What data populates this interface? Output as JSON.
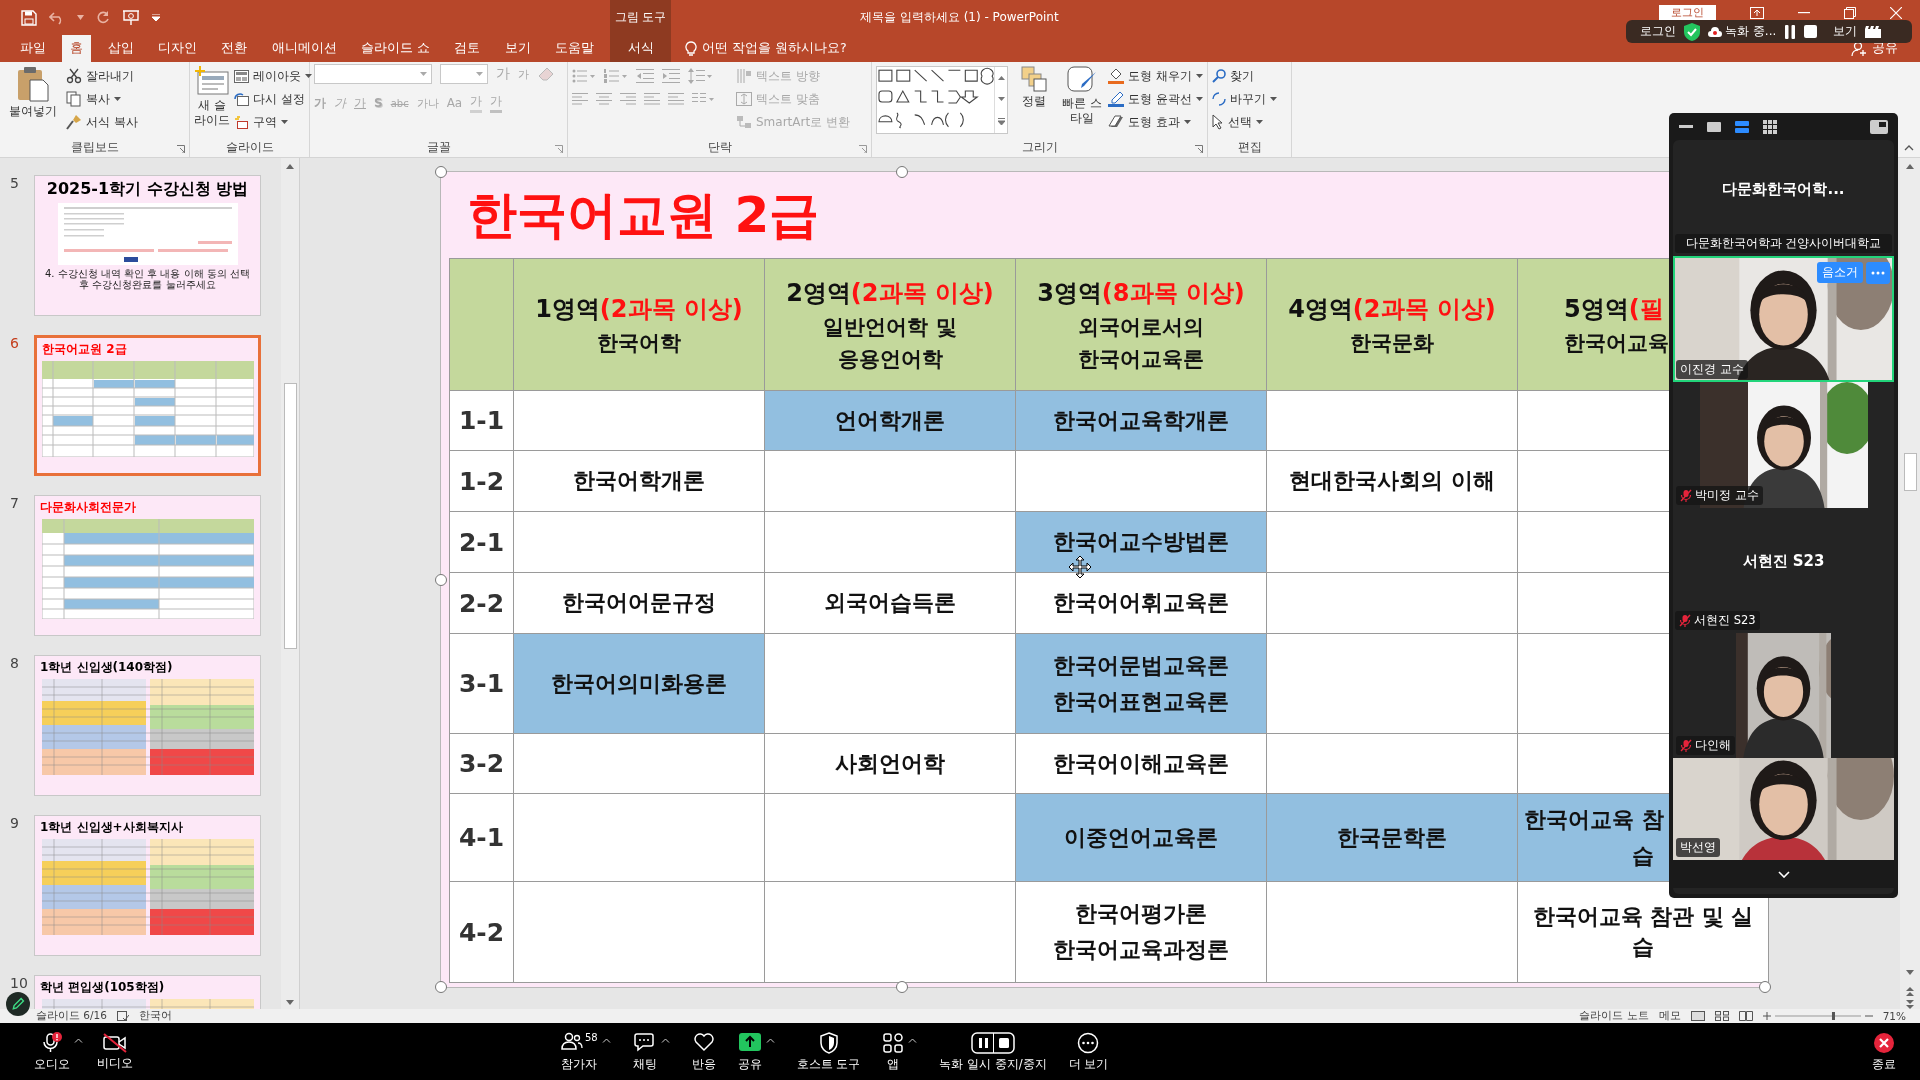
{
  "window": {
    "title": "제목을 입력하세요 (1) - PowerPoint",
    "context_group": "그림 도구",
    "login_button": "로그인",
    "share_button": "공유"
  },
  "tabs": [
    {
      "label": "파일",
      "selected": false,
      "contextual": false
    },
    {
      "label": "홈",
      "selected": true,
      "contextual": false
    },
    {
      "label": "삽입",
      "selected": false,
      "contextual": false
    },
    {
      "label": "디자인",
      "selected": false,
      "contextual": false
    },
    {
      "label": "전환",
      "selected": false,
      "contextual": false
    },
    {
      "label": "애니메이션",
      "selected": false,
      "contextual": false
    },
    {
      "label": "슬라이드 쇼",
      "selected": false,
      "contextual": false
    },
    {
      "label": "검토",
      "selected": false,
      "contextual": false
    },
    {
      "label": "보기",
      "selected": false,
      "contextual": false
    },
    {
      "label": "도움말",
      "selected": false,
      "contextual": false
    },
    {
      "label": "서식",
      "selected": false,
      "contextual": true
    }
  ],
  "tell_me": "어떤 작업을 원하시나요?",
  "clipboard": {
    "label": "클립보드",
    "paste": "붙여넣기",
    "cut": "잘라내기",
    "copy": "복사",
    "format_painter": "서식 복사"
  },
  "slides_group": {
    "label": "슬라이드",
    "new_slide": "새 슬라이드",
    "layout": "레이아웃",
    "reset": "다시 설정",
    "section": "구역"
  },
  "font": {
    "label": "글꼴",
    "disabled": true,
    "grow": "가",
    "shrink": "가",
    "buttons": [
      {
        "kind": "bold",
        "label": "가"
      },
      {
        "kind": "italic",
        "label": "가"
      },
      {
        "kind": "underline",
        "label": "가"
      },
      {
        "kind": "shadow",
        "label": "S"
      },
      {
        "kind": "strike",
        "label": "abc"
      },
      {
        "kind": "spacing",
        "label": "가나"
      },
      {
        "kind": "case",
        "label": "Aa"
      },
      {
        "kind": "highlight",
        "label": "가"
      },
      {
        "kind": "color",
        "label": "가"
      }
    ]
  },
  "paragraph": {
    "label": "단락",
    "disabled": true,
    "text_direction": "텍스트 방향",
    "align_text": "텍스트 맞춤",
    "smartart": "SmartArt로 변환"
  },
  "drawing": {
    "label": "그리기",
    "arrange": "정렬",
    "quick_styles": "빠른 스타일",
    "fill": "도형 채우기",
    "outline": "도형 윤곽선",
    "effects": "도형 효과"
  },
  "editing": {
    "label": "편집",
    "find": "찾기",
    "replace": "바꾸기",
    "select": "선택"
  },
  "zoom_toolbar": {
    "login": "로그인",
    "recording": "녹화 중...",
    "view": "보기"
  },
  "thumbnails": [
    {
      "number": "5",
      "selected": false,
      "kind": "form",
      "title": "2025-1학기 수강신청 방법",
      "color": "#000000",
      "caption": "4. 수강신청 내역 확인 후 내용 이해 동의 선택 후 수강신청완료를 눌러주세요"
    },
    {
      "number": "6",
      "selected": true,
      "kind": "table",
      "title": "한국어교원 2급",
      "color": "#ff0000"
    },
    {
      "number": "7",
      "selected": false,
      "kind": "two-column",
      "title": "다문화사회전문가",
      "color": "#ff0000"
    },
    {
      "number": "8",
      "selected": false,
      "kind": "color-grid",
      "title": "1학년 신입생(140학점)",
      "color": "#000000"
    },
    {
      "number": "9",
      "selected": false,
      "kind": "color-grid",
      "title": "1학년 신입생+사회복지사",
      "color": "#000000"
    },
    {
      "number": "10",
      "selected": false,
      "kind": "color-grid",
      "title": "학년 편입생(105학점)",
      "color": "#000000"
    }
  ],
  "slide": {
    "title": "한국어교원 2급",
    "table": {
      "columns": [
        {
          "area": "1영역",
          "requirement": "(2과목 이상)",
          "subject_lines": [
            "한국어학"
          ]
        },
        {
          "area": "2영역",
          "requirement": "(2과목 이상)",
          "subject_lines": [
            "일반언어학 및",
            "응용언어학"
          ]
        },
        {
          "area": "3영역",
          "requirement": "(8과목 이상)",
          "subject_lines": [
            "외국어로서의",
            "한국어교육론"
          ]
        },
        {
          "area": "4영역",
          "requirement": "(2과목 이상)",
          "subject_lines": [
            "한국문화"
          ]
        },
        {
          "area": "5영역",
          "requirement": "(필",
          "subject_lines": [
            "한국어교육"
          ],
          "clipped": true
        }
      ],
      "rows": [
        {
          "label": "1-1",
          "cells": [
            {
              "highlighted": false
            },
            {
              "highlighted": true,
              "lines": [
                "언어학개론"
              ]
            },
            {
              "highlighted": true,
              "lines": [
                "한국어교육학개론"
              ]
            },
            {
              "highlighted": false
            },
            {
              "highlighted": false
            }
          ]
        },
        {
          "label": "1-2",
          "cells": [
            {
              "highlighted": false,
              "lines": [
                "한국어학개론"
              ]
            },
            {
              "highlighted": false
            },
            {
              "highlighted": false
            },
            {
              "highlighted": false,
              "lines": [
                "현대한국사회의 이해"
              ]
            },
            {
              "highlighted": false
            }
          ]
        },
        {
          "label": "2-1",
          "cells": [
            {
              "highlighted": false
            },
            {
              "highlighted": false
            },
            {
              "highlighted": true,
              "lines": [
                "한국어교수방법론"
              ]
            },
            {
              "highlighted": false
            },
            {
              "highlighted": false
            }
          ]
        },
        {
          "label": "2-2",
          "cells": [
            {
              "highlighted": false,
              "lines": [
                "한국어어문규정"
              ]
            },
            {
              "highlighted": false,
              "lines": [
                "외국어습득론"
              ]
            },
            {
              "highlighted": false,
              "lines": [
                "한국어어휘교육론"
              ]
            },
            {
              "highlighted": false
            },
            {
              "highlighted": false
            }
          ]
        },
        {
          "label": "3-1",
          "cells": [
            {
              "highlighted": true,
              "lines": [
                "한국어의미화용론"
              ]
            },
            {
              "highlighted": false
            },
            {
              "highlighted": true,
              "lines": [
                "한국어문법교육론",
                "한국어표현교육론"
              ]
            },
            {
              "highlighted": false
            },
            {
              "highlighted": false
            }
          ]
        },
        {
          "label": "3-2",
          "cells": [
            {
              "highlighted": false
            },
            {
              "highlighted": false,
              "lines": [
                "사회언어학"
              ]
            },
            {
              "highlighted": false,
              "lines": [
                "한국어이해교육론"
              ]
            },
            {
              "highlighted": false
            },
            {
              "highlighted": false
            }
          ]
        },
        {
          "label": "4-1",
          "cells": [
            {
              "highlighted": false
            },
            {
              "highlighted": false
            },
            {
              "highlighted": true,
              "lines": [
                "이중언어교육론"
              ]
            },
            {
              "highlighted": true,
              "lines": [
                "한국문학론"
              ]
            },
            {
              "highlighted": true,
              "lines": [
                "한국어교육 참",
                "습"
              ],
              "clipped": true
            }
          ]
        },
        {
          "label": "4-2",
          "cells": [
            {
              "highlighted": false
            },
            {
              "highlighted": false
            },
            {
              "highlighted": false,
              "lines": [
                "한국어평가론",
                "한국어교육과정론"
              ]
            },
            {
              "highlighted": false
            },
            {
              "highlighted": false,
              "lines": [
                "한국어교육 참관 및 실습"
              ]
            }
          ]
        }
      ]
    }
  },
  "zoom_panel": {
    "tiles": [
      {
        "kind": "name",
        "display": "다문화한국어학...",
        "name": "다문화한국어학과 건양사이버대학교",
        "muted": false,
        "speaking": false
      },
      {
        "kind": "video",
        "name": "이진경 교수",
        "muted": false,
        "speaking": true,
        "mute_button": "음소거"
      },
      {
        "kind": "video",
        "name": "박미정 교수",
        "muted": true,
        "speaking": false
      },
      {
        "kind": "name",
        "display": "서현진 S23",
        "name": "서현진 S23",
        "muted": true,
        "speaking": false
      },
      {
        "kind": "video",
        "name": "다인해",
        "muted": true,
        "speaking": false
      },
      {
        "kind": "video",
        "name": "박선영",
        "muted": false,
        "speaking": false
      }
    ]
  },
  "status_bar": {
    "slide_position": "슬라이드 6/16",
    "language": "한국어",
    "notes": "슬라이드 노트",
    "comments": "메모",
    "zoom_slider": {
      "level": 0.68
    },
    "zoom": "71%"
  },
  "meeting_controls": [
    {
      "kind": "audio",
      "label": "오디오",
      "caret": true
    },
    {
      "kind": "video",
      "label": "비디오",
      "caret": false
    },
    {
      "kind": "participants",
      "label": "참가자",
      "count": "58",
      "caret": true
    },
    {
      "kind": "chat",
      "label": "채팅",
      "caret": true
    },
    {
      "kind": "reactions",
      "label": "반응",
      "caret": false
    },
    {
      "kind": "share",
      "label": "공유",
      "caret": true
    },
    {
      "kind": "host",
      "label": "호스트 도구",
      "caret": false
    },
    {
      "kind": "apps",
      "label": "앱",
      "caret": true
    },
    {
      "kind": "record",
      "label": "녹화 일시 중지/중지",
      "caret": false
    },
    {
      "kind": "more",
      "label": "더 보기",
      "caret": false
    },
    {
      "kind": "end",
      "label": "종료",
      "caret": false
    }
  ]
}
